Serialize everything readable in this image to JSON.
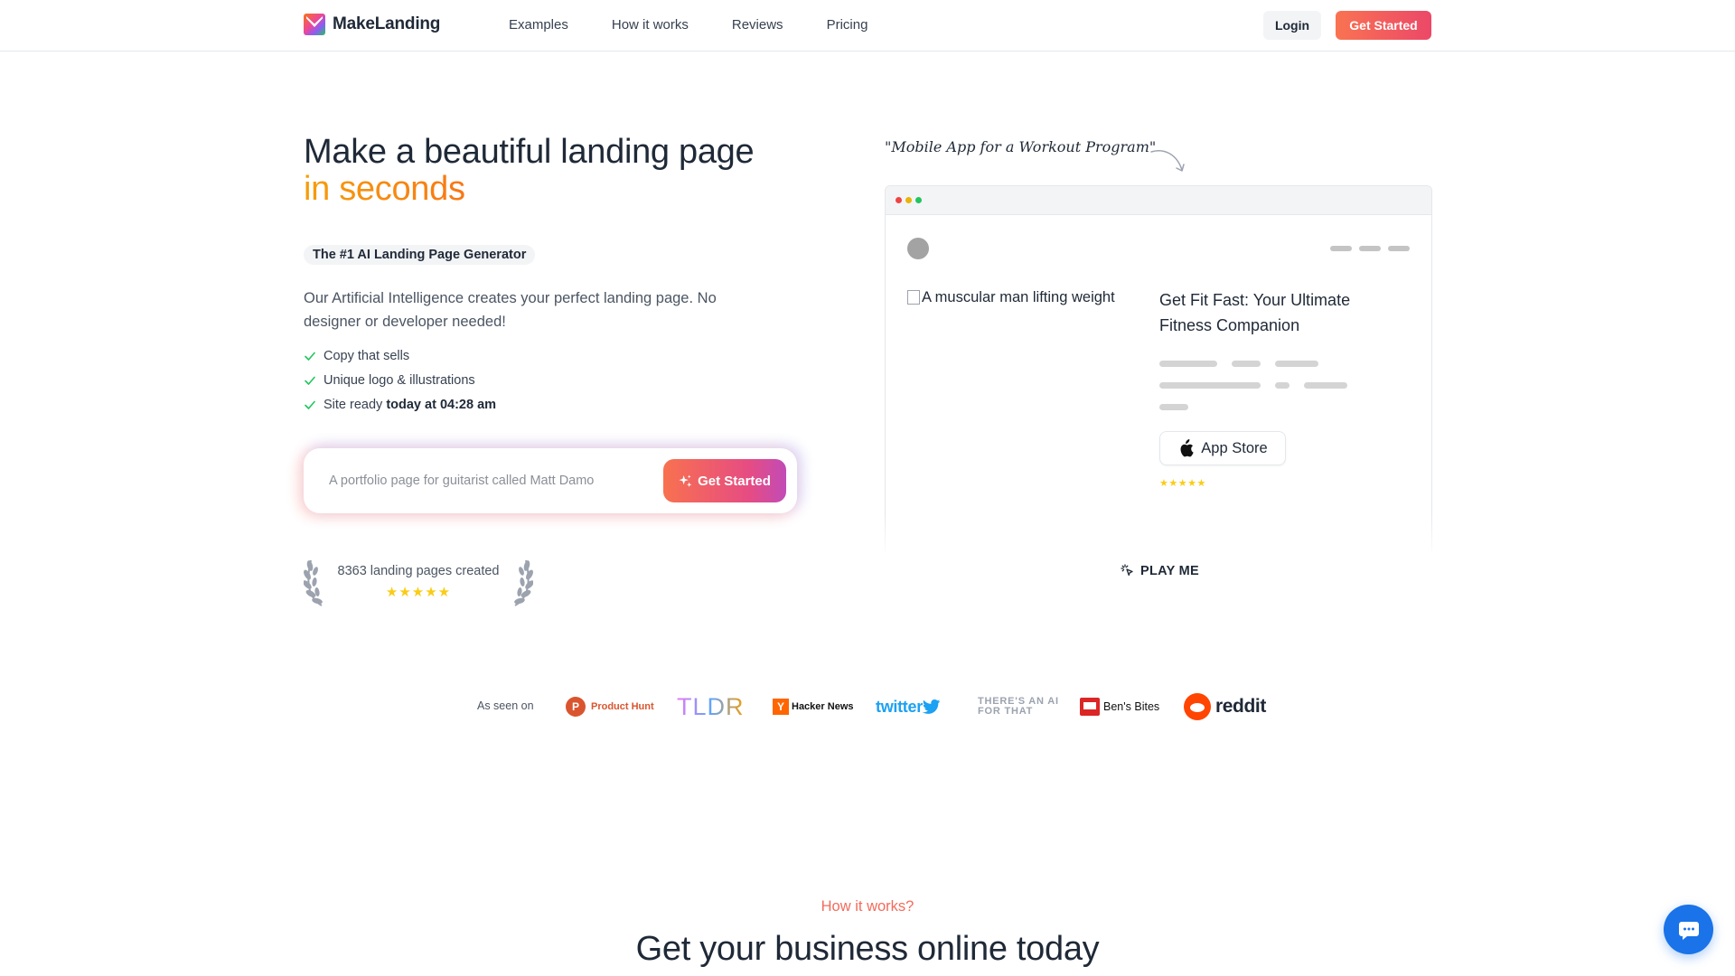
{
  "nav": {
    "brand": "MakeLanding",
    "links": [
      "Examples",
      "How it works",
      "Reviews",
      "Pricing"
    ],
    "login": "Login",
    "get_started": "Get Started"
  },
  "hero": {
    "title_line1": "Make a beautiful landing page",
    "title_line2": "in seconds",
    "badge": "The #1 AI Landing Page Generator",
    "description": "Our Artificial Intelligence creates your perfect landing page. No designer or developer needed!",
    "features": [
      "Copy that sells",
      "Unique logo & illustrations"
    ],
    "feature3_prefix": "Site ready ",
    "feature3_highlight": "today at 04:28 am",
    "input_placeholder": "A portfolio page for guitarist called Matt Damo",
    "cta": "Get Started",
    "pages_created": "8363 landing pages created",
    "stars": "★★★★★"
  },
  "preview": {
    "handnote": "\"Mobile App for a Workout Program\"",
    "image_alt": "A muscular man lifting weight",
    "site_title": "Get Fit Fast: Your Ultimate Fitness Companion",
    "app_store": "App Store",
    "stars": "★★★★★",
    "play": "PLAY ME"
  },
  "press": {
    "label": "As seen on",
    "logos": [
      "product-hunt",
      "tldr",
      "hacker-news",
      "twitter",
      "theres-an-ai-for-that",
      "bens-bites",
      "reddit"
    ],
    "product_hunt": "Product Hunt",
    "tldr": "TLDR",
    "hacker_news": "Hacker News",
    "twitter": "twitter",
    "aithat": "THERE'S AN AI FOR THAT",
    "bens_bites": "Ben's Bites",
    "reddit": "reddit"
  },
  "how": {
    "label": "How it works?",
    "title": "Get your business online today"
  },
  "colors": {
    "accent_orange": "#f97352",
    "accent_pink": "#ec4868",
    "check_green": "#22c55e",
    "chat_blue": "#1a73e8"
  }
}
